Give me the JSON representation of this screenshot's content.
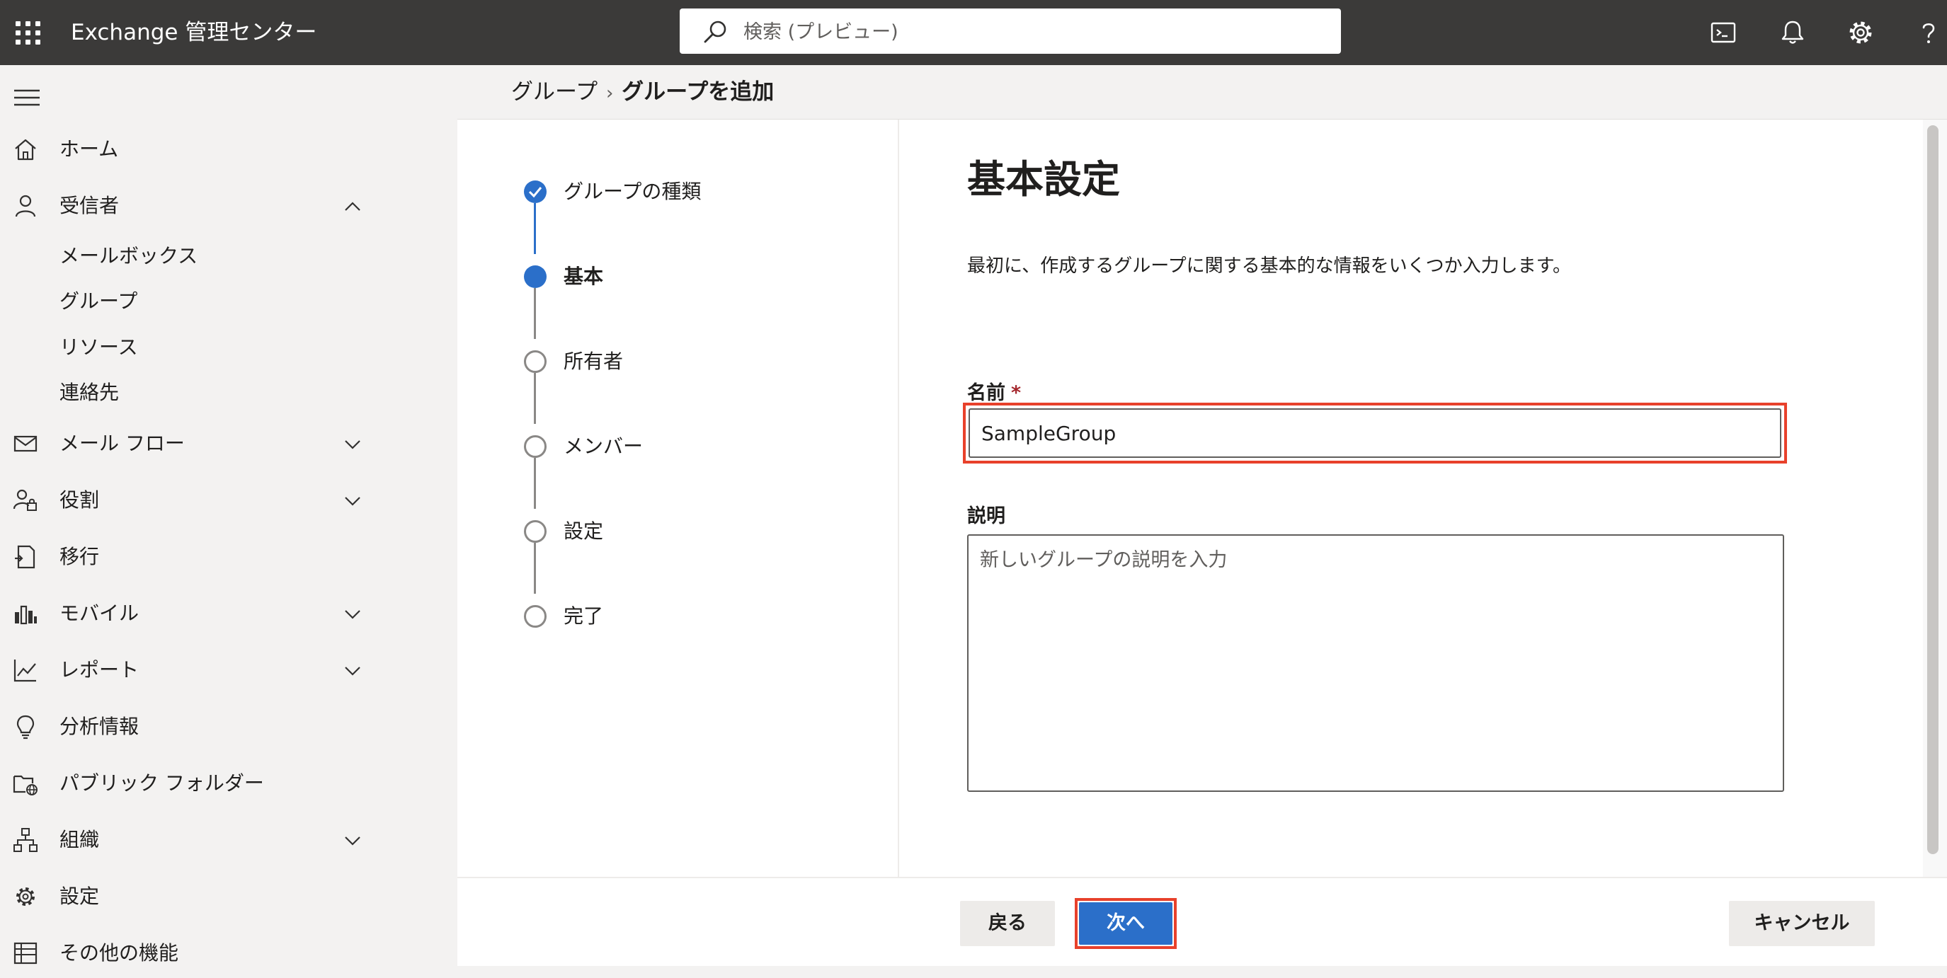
{
  "header": {
    "app_title": "Exchange 管理センター",
    "search_placeholder": "検索 (プレビュー)"
  },
  "nav": {
    "items": [
      {
        "label": "ホーム",
        "icon": "home-icon"
      },
      {
        "label": "受信者",
        "icon": "person-icon",
        "expanded": true,
        "children": [
          "メールボックス",
          "グループ",
          "リソース",
          "連絡先"
        ]
      },
      {
        "label": "メール フロー",
        "icon": "mail-icon"
      },
      {
        "label": "役割",
        "icon": "roles-icon"
      },
      {
        "label": "移行",
        "icon": "migration-icon"
      },
      {
        "label": "モバイル",
        "icon": "mobile-icon"
      },
      {
        "label": "レポート",
        "icon": "report-icon"
      },
      {
        "label": "分析情報",
        "icon": "lightbulb-icon"
      },
      {
        "label": "パブリック フォルダー",
        "icon": "public-folder-icon"
      },
      {
        "label": "組織",
        "icon": "organization-icon"
      },
      {
        "label": "設定",
        "icon": "gear-icon"
      },
      {
        "label": "その他の機能",
        "icon": "table-icon"
      }
    ]
  },
  "breadcrumb": {
    "parent": "グループ",
    "current": "グループを追加"
  },
  "steps": [
    {
      "label": "グループの種類",
      "state": "done"
    },
    {
      "label": "基本",
      "state": "current"
    },
    {
      "label": "所有者",
      "state": "todo"
    },
    {
      "label": "メンバー",
      "state": "todo"
    },
    {
      "label": "設定",
      "state": "todo"
    },
    {
      "label": "完了",
      "state": "todo"
    }
  ],
  "form": {
    "heading": "基本設定",
    "description": "最初に、作成するグループに関する基本的な情報をいくつか入力します。",
    "name_label": "名前",
    "required_mark": "*",
    "name_value": "SampleGroup",
    "desc_label": "説明",
    "desc_placeholder": "新しいグループの説明を入力"
  },
  "buttons": {
    "back": "戻る",
    "next": "次へ",
    "cancel": "キャンセル"
  },
  "colors": {
    "topbar": "#3b3a39",
    "accent": "#2b6fc9",
    "highlight": "#e8412b"
  }
}
